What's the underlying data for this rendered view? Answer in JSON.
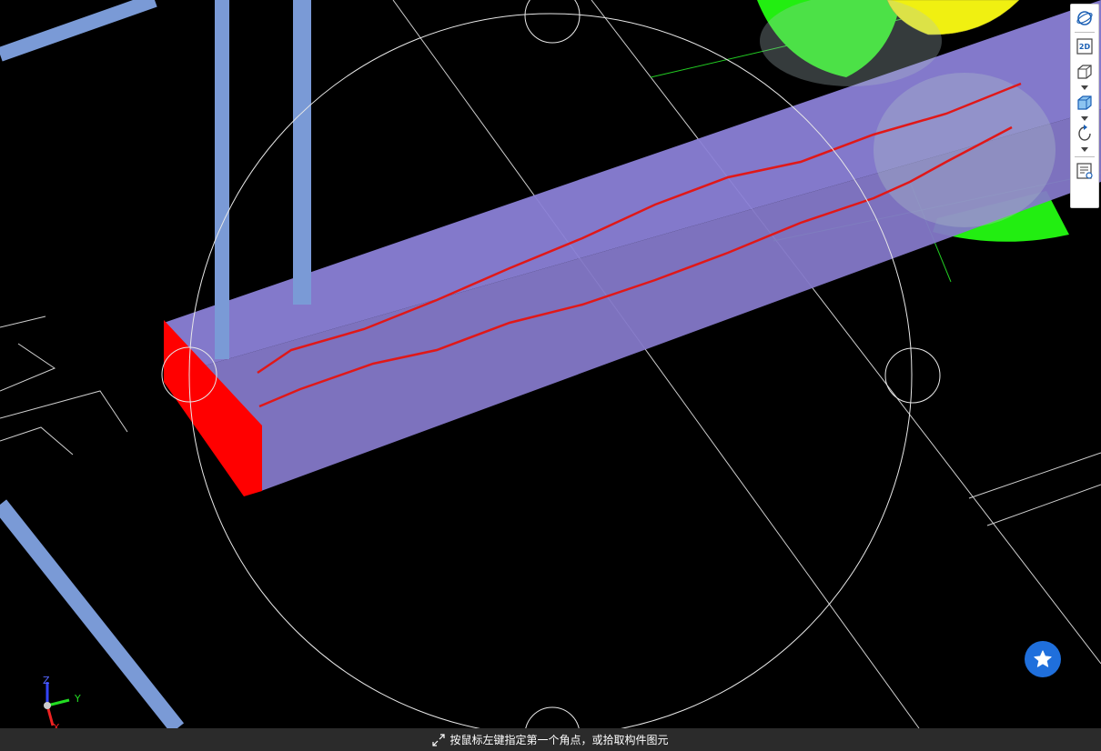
{
  "toolbar": {
    "items": [
      {
        "name": "orbit-icon"
      },
      {
        "name": "2d-view-icon",
        "label": "2D"
      },
      {
        "name": "3d-box-outline-icon"
      },
      {
        "name": "3d-box-shaded-icon"
      },
      {
        "name": "rotate-icon"
      },
      {
        "name": "property-panel-icon"
      }
    ]
  },
  "axes": {
    "z_label": "Z",
    "y_label": "Y",
    "x_label": "X"
  },
  "status": {
    "prompt": "按鼠标左键指定第一个角点，或拾取构件图元"
  },
  "fab": {
    "icon": "star-icon"
  },
  "colors": {
    "background": "#000000",
    "beam_face": "#8a7fd6",
    "beam_end": "#ff0000",
    "rebar_line": "#e01818",
    "column_pipe": "#7a9ad6",
    "green_sphere": "#22ee11",
    "yellow_mesh": "#f0f011",
    "wireframe": "#d9d9d9",
    "fab": "#1f6fdc",
    "statusbar": "#2b2b2b"
  }
}
